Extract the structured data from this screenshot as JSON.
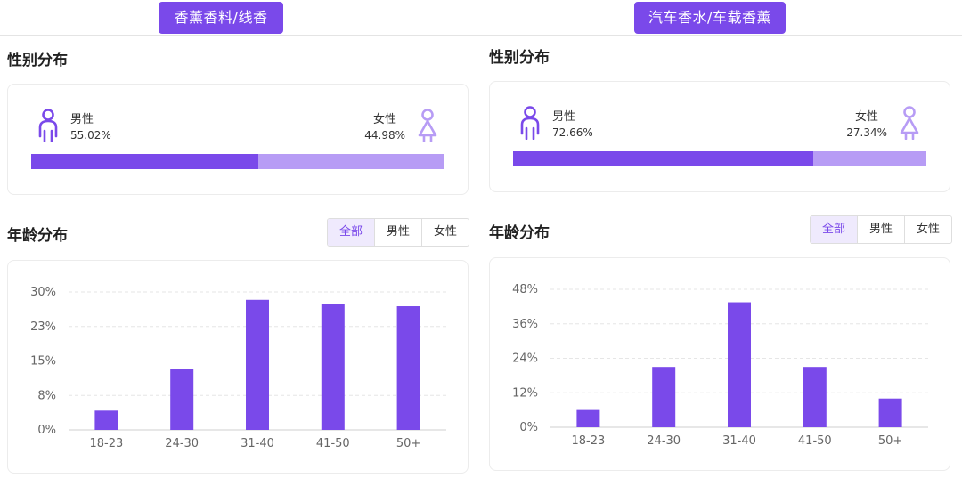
{
  "panels": [
    {
      "tag": "香薰香料/线香",
      "gender_title": "性别分布",
      "male_label": "男性",
      "male_pct_text": "55.02%",
      "male_pct": 55.02,
      "female_label": "女性",
      "female_pct_text": "44.98%",
      "female_pct": 44.98,
      "age_title": "年龄分布",
      "tabs": [
        "全部",
        "男性",
        "女性"
      ]
    },
    {
      "tag": "汽车香水/车载香薰",
      "gender_title": "性别分布",
      "male_label": "男性",
      "male_pct_text": "72.66%",
      "male_pct": 72.66,
      "female_label": "女性",
      "female_pct_text": "27.34%",
      "female_pct": 27.34,
      "age_title": "年龄分布",
      "tabs": [
        "全部",
        "男性",
        "女性"
      ]
    }
  ],
  "colors": {
    "accent": "#7a49ea",
    "female_bar": "#b79cf5",
    "tab_active_bg": "#efeafd"
  },
  "chart_data": [
    {
      "type": "bar",
      "categories": [
        "18-23",
        "24-30",
        "31-40",
        "41-50",
        "50+"
      ],
      "values": [
        4.2,
        13.2,
        28.3,
        27.4,
        26.9
      ],
      "yticks": [
        "0%",
        "8%",
        "15%",
        "23%",
        "30%"
      ],
      "ylim": [
        0,
        30
      ],
      "grid": true
    },
    {
      "type": "bar",
      "categories": [
        "18-23",
        "24-30",
        "31-40",
        "41-50",
        "50+"
      ],
      "values": [
        6,
        21,
        43.5,
        21,
        10
      ],
      "yticks": [
        "0%",
        "12%",
        "24%",
        "36%",
        "48%"
      ],
      "ylim": [
        0,
        48
      ],
      "grid": true
    }
  ]
}
